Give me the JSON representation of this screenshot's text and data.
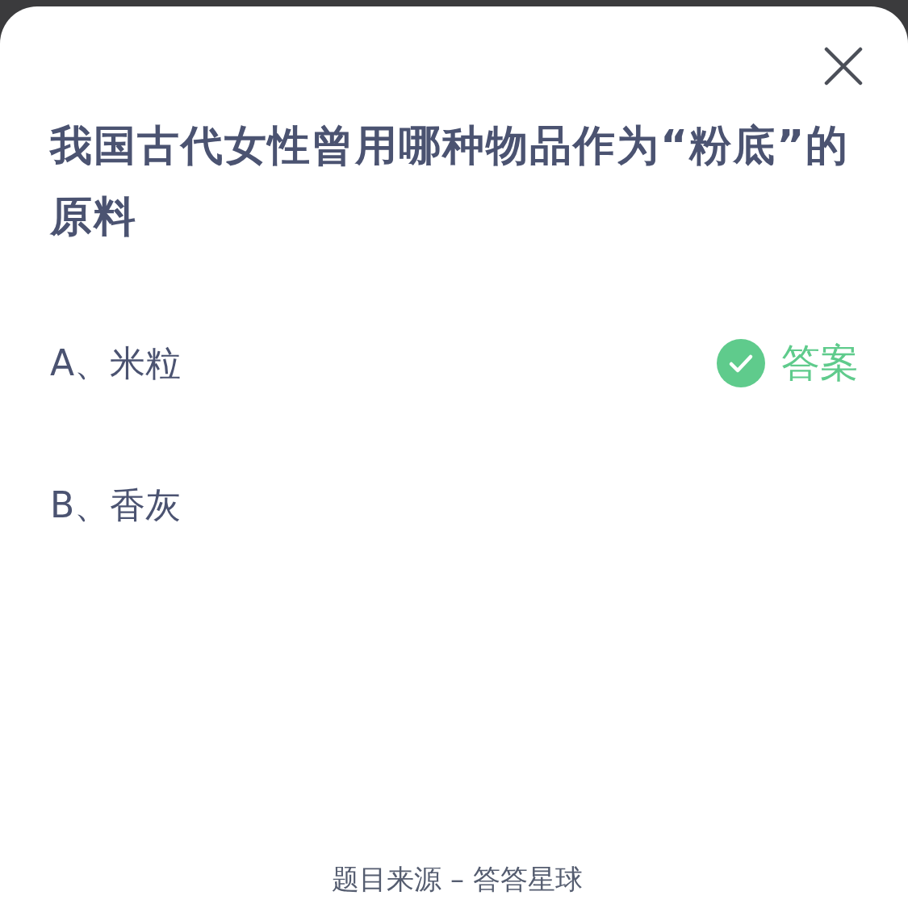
{
  "question": "我国古代女性曾用哪种物品作为“粉底”的原料",
  "options": [
    {
      "label": "A、米粒",
      "correct": true
    },
    {
      "label": "B、香灰",
      "correct": false
    }
  ],
  "answer_label": "答案",
  "footer": "题目来源 – 答答星球"
}
